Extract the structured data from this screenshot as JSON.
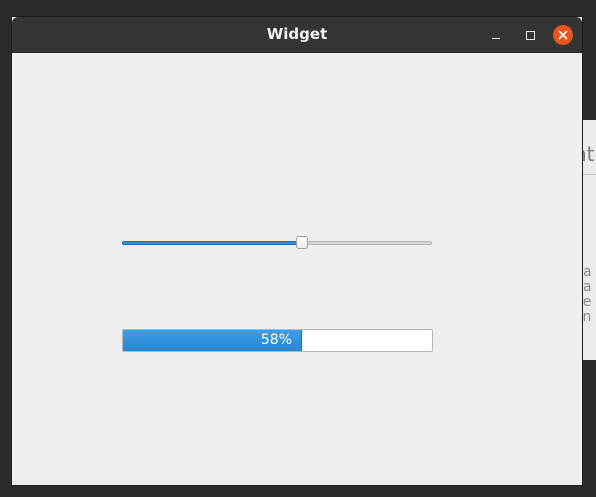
{
  "window": {
    "title": "Widget"
  },
  "slider": {
    "value_fraction": 0.58,
    "accent": "#2f8fdd"
  },
  "progress": {
    "value": 58,
    "label": "58%",
    "accent": "#2f8fdd"
  },
  "background_window": {
    "title_fragment": "nt",
    "line_fragments": [
      "ct",
      "o a",
      "o a",
      "file",
      "oin"
    ]
  },
  "icons": {
    "minimize": "minimize-icon",
    "maximize": "maximize-icon",
    "close": "close-icon"
  },
  "colors": {
    "titlebar": "#343434",
    "close_button": "#e95420",
    "window_bg": "#efefef"
  }
}
